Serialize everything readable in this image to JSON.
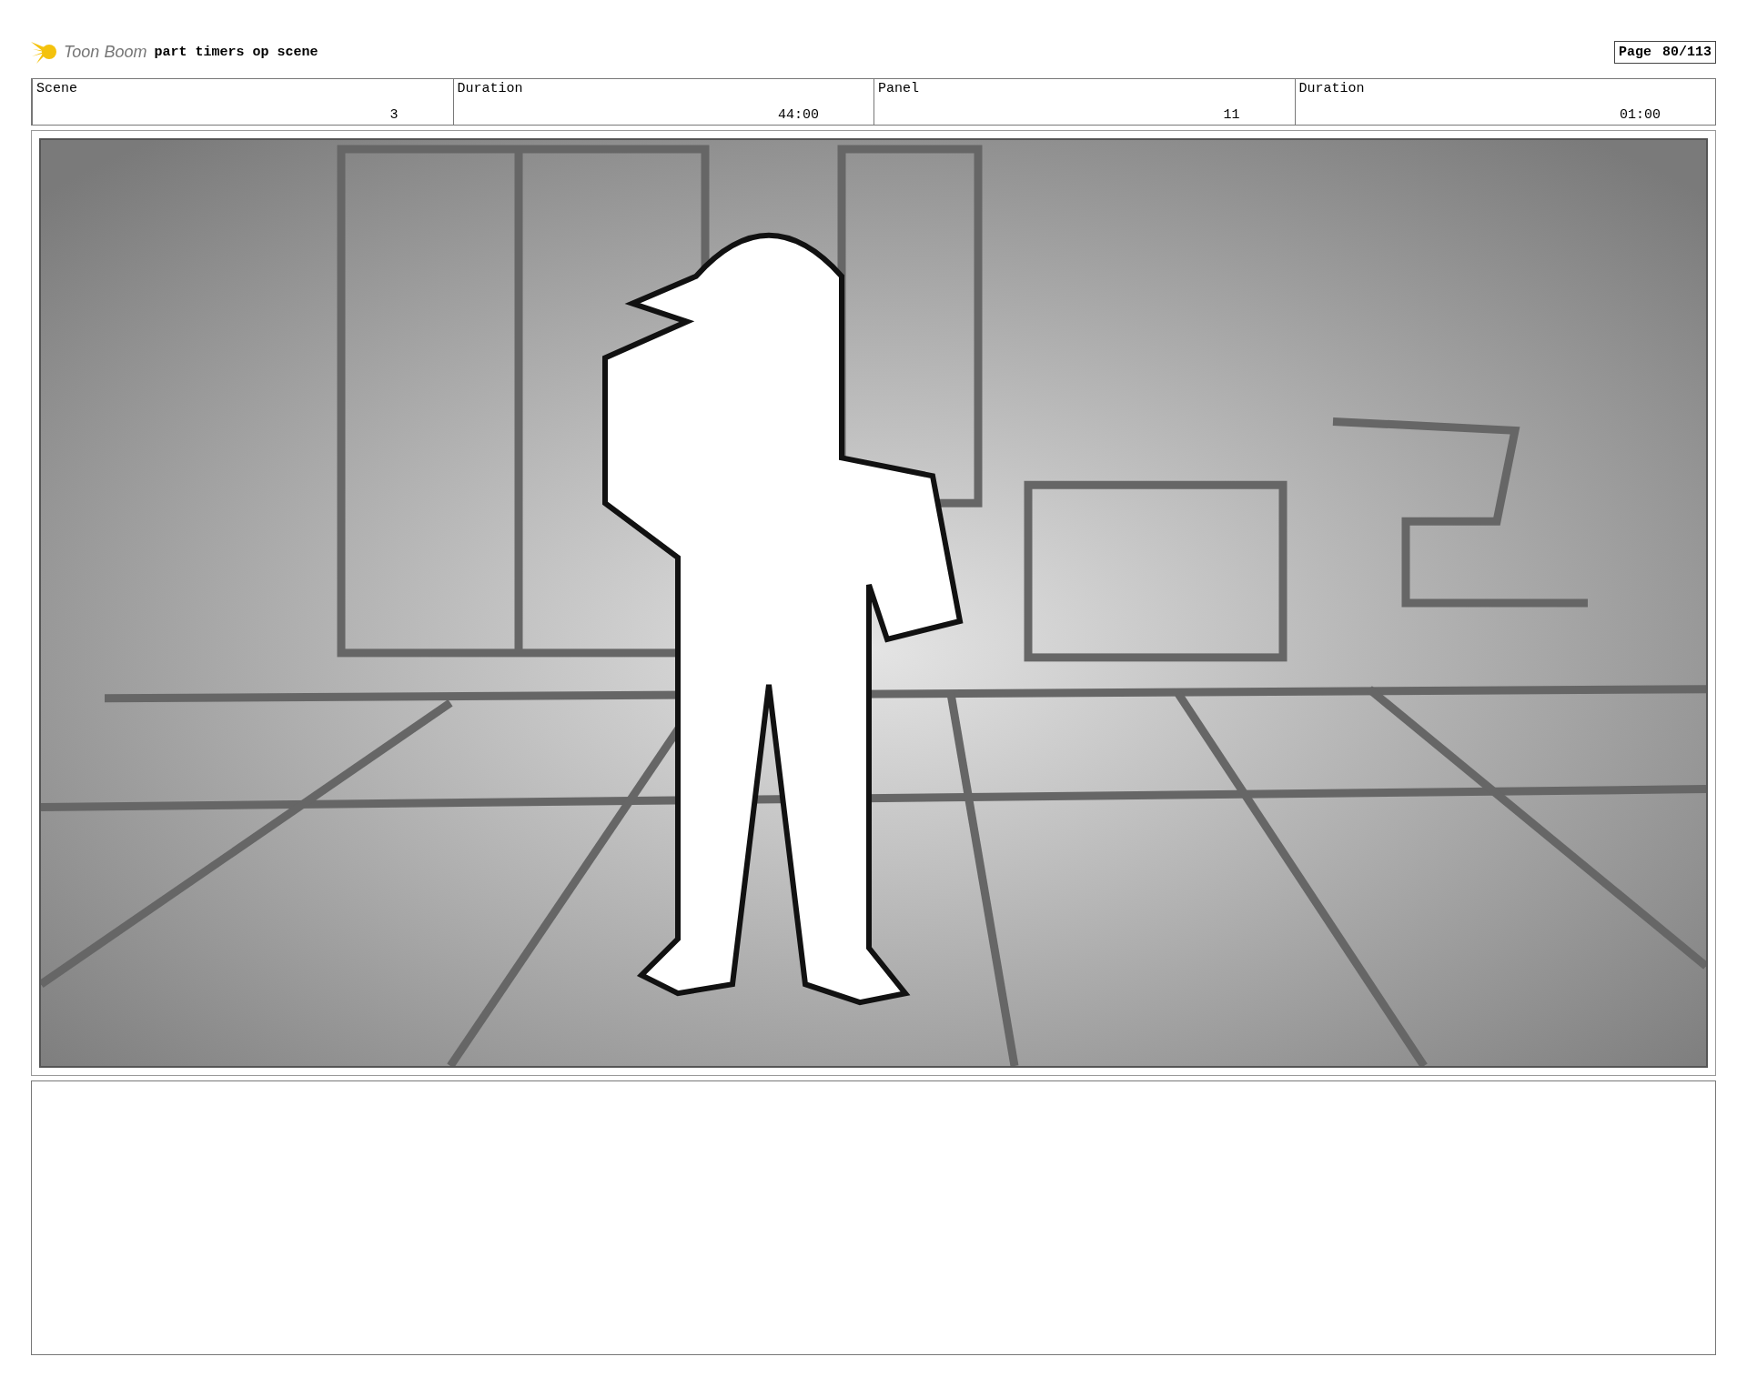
{
  "header": {
    "logo_text": "Toon Boom",
    "title": "part timers op scene",
    "page_label": "Page",
    "page_number": "80/113"
  },
  "fields": [
    {
      "label": "Scene",
      "value": "3"
    },
    {
      "label": "Duration",
      "value": "44:00"
    },
    {
      "label": "Panel",
      "value": "11"
    },
    {
      "label": "Duration",
      "value": "01:00"
    }
  ]
}
